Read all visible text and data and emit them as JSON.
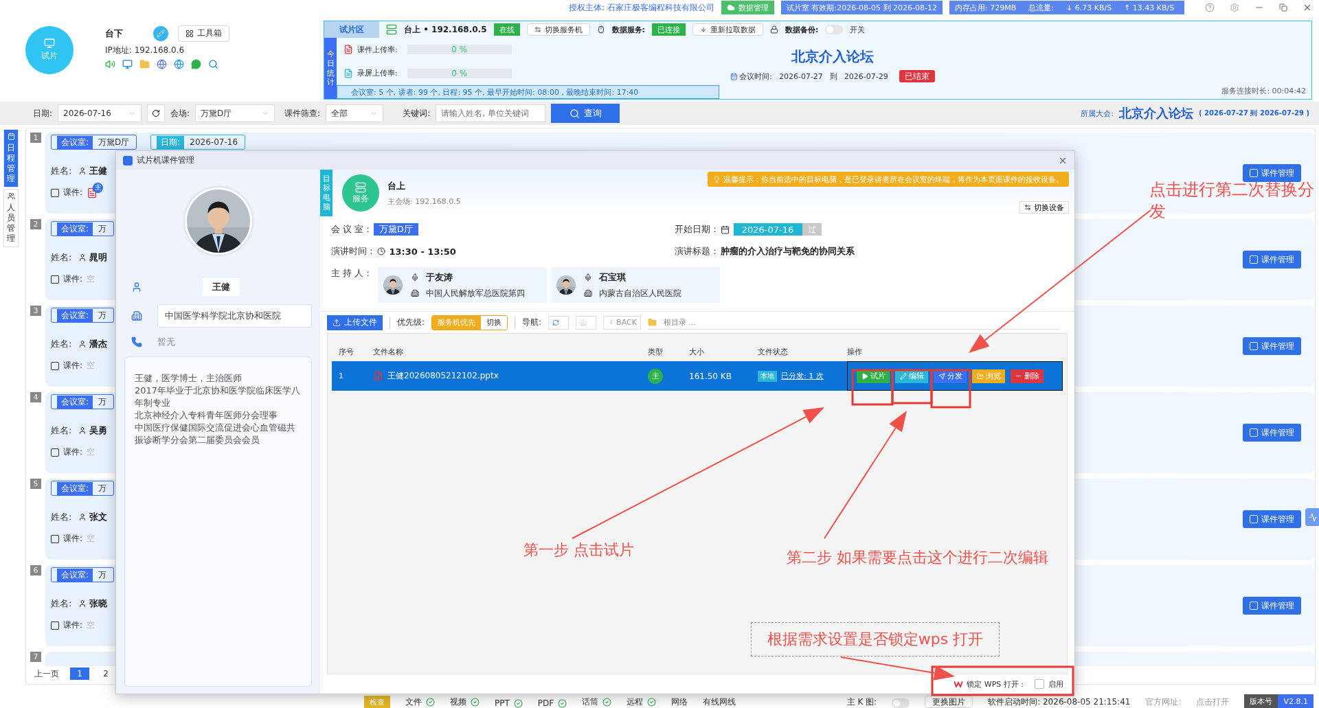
{
  "header": {
    "avatar_label": "试片",
    "role": "台下",
    "toolbox_button": "工具箱",
    "ip": "IP地址: 192.168.0.6"
  },
  "top_bar": {
    "licensee": "授权主体: 石家庄极客编程科技有限公司",
    "data_button": "数据管理",
    "validity": "试片室 有效期:2026-08-05 到 2026-08-12",
    "memory": "内存占用:  729MB",
    "traffic_label": "总流量:",
    "download": "↓ 6.73 KB/S",
    "upload": "↑ 13.43 KB/S"
  },
  "info_panel": {
    "tab": "试片区",
    "server": "台上 • 192.168.0.5",
    "server_status": "在线",
    "switch_server": "切换服务机",
    "data_service_label": "数据服务:",
    "data_service_status": "已连接",
    "refetch_button": "重新拉取数据",
    "backup_label": "数据备份:",
    "backup_on": false,
    "backup_switch_label": "开关",
    "stats_label": "今日统计",
    "rates": [
      {
        "label": "课件上传率:",
        "level": 0,
        "reading": "0 %"
      },
      {
        "label": "录屏上传率:",
        "level": 0,
        "reading": "0 %"
      }
    ],
    "summary": "会议室:  5 个,  讲者:  99 个,  日程:  95 个,  最早开始时间:  08:00 ,    最晚结束时间:  17:40",
    "conference": "北京介入论坛",
    "meeting_time_label": "会议时间:",
    "meeting_start": "2026-07-27",
    "meeting_to": "到",
    "meeting_end": "2026-07-29",
    "meeting_status": "已结束",
    "uptime": "服务连接时长: 00:04:42"
  },
  "filter_bar": {
    "date_label": "日期:",
    "date": "2026-07-16",
    "venue_label": "会场:",
    "venue": "万黛D厅",
    "course_filter_label": "课件筛查:",
    "course_filter": "全部",
    "keyword_label": "关键词:",
    "keyword_placeholder": "请输入姓名, 单位关键词",
    "search_button": "查询",
    "conference_label": "所属大会:",
    "conference": "北京介入论坛",
    "conference_dates": "( 2026-07-27 到 2026-07-29 )"
  },
  "side_nav": [
    {
      "label": "日程管理",
      "selected": true
    },
    {
      "label": "人员管理",
      "selected": false
    }
  ],
  "schedule_cards": [
    {
      "number": "1",
      "room_label": "会议室:",
      "room": "万黛D厅",
      "date_label": "日期:",
      "date": "2026-07-16",
      "name_label": "姓名:",
      "name": "王健",
      "course_label": "课件:",
      "course": {
        "kind": "file",
        "badge": "主"
      },
      "manage_button": "课件管理"
    },
    {
      "number": "2",
      "room_label": "会议室:",
      "room": "万",
      "name_label": "姓名:",
      "name": "晁明",
      "course_label": "课件:",
      "course": {
        "kind": "empty",
        "text": "空"
      },
      "manage_button": "课件管理"
    },
    {
      "number": "3",
      "room_label": "会议室:",
      "room": "万",
      "name_label": "姓名:",
      "name": "潘杰",
      "course_label": "课件:",
      "course": {
        "kind": "empty",
        "text": "空"
      },
      "manage_button": "课件管理"
    },
    {
      "number": "4",
      "room_label": "会议室:",
      "room": "万",
      "name_label": "姓名:",
      "name": "吴勇",
      "course_label": "课件:",
      "course": {
        "kind": "empty",
        "text": "空"
      },
      "manage_button": "课件管理"
    },
    {
      "number": "5",
      "room_label": "会议室:",
      "room": "万",
      "name_label": "姓名:",
      "name": "张文",
      "course_label": "课件:",
      "course": {
        "kind": "empty",
        "text": "空"
      },
      "manage_button": "课件管理"
    },
    {
      "number": "6",
      "room_label": "会议室:",
      "room": "万",
      "name_label": "姓名:",
      "name": "张晓",
      "course_label": "课件:",
      "course": {
        "kind": "empty",
        "text": "空"
      },
      "manage_button": "课件管理"
    },
    {
      "number": "7"
    }
  ],
  "pagination": {
    "prev": "上一页",
    "pages": [
      {
        "label": "1",
        "selected": true
      },
      {
        "label": "2",
        "selected": false
      }
    ]
  },
  "status_bar": {
    "check_button": "检查",
    "checks": [
      "文件",
      "视频",
      "PPT",
      "PDF",
      "话筒",
      "远程"
    ],
    "network_label": "网络",
    "network": "有线网线",
    "k_image_label": "主 K 图:",
    "k_image_on": false,
    "change_image": "更换图片",
    "start_time": "软件启动时间: 2026-08-05 21:15:41",
    "website_label": "官方网址:",
    "website_link": "点击打开",
    "version_label": "版本号",
    "version": "V2.8.1"
  },
  "dialog": {
    "title": "试片机课件管理",
    "speaker": {
      "name": "王健",
      "hospital": "中国医学科学院北京协和医院",
      "phone": "暂无",
      "bio": [
        "王健，医学博士，主治医师",
        "2017年毕业于北京协和医学院临床医学八年制专业",
        "北京神经介入专科青年医师分会理事",
        "中国医疗保健国际交流促进会心血管磁共振诊断学分会第二届委员会会员"
      ]
    },
    "target": {
      "label": "目标电脑",
      "badge": "服务",
      "name": "台上",
      "address": "主会场: 192.168.0.5",
      "tip": "温馨提示：你当前选中的目标电脑，是已登录讲者所在会议室的终端，将作为本页面课件的接收设备。",
      "switch_button": "切换设备"
    },
    "room_label": "会 议 室 :",
    "room": "万黛D厅",
    "start_label": "开始日期 :",
    "start_date": "2026-07-16",
    "start_badge": "过",
    "time_label": "演讲时间 :",
    "time": "13:30 - 13:50",
    "topic_label": "演讲标题 :",
    "topic": "肿瘤的介入治疗与靶免的协同关系",
    "hosts_label": "主 持 人 :",
    "hosts": [
      {
        "name": "于友涛",
        "org": "中国人民解放军总医院第四"
      },
      {
        "name": "石宝琪",
        "org": "内蒙古自治区人民医院"
      }
    ],
    "toolbar": {
      "upload": "上传文件",
      "priority_label": "优先级:",
      "priority_options": [
        {
          "label": "服务机优先",
          "selected": true
        },
        {
          "label": "切换",
          "selected": false
        }
      ],
      "nav_label": "导航:",
      "back": "BACK",
      "path": "根目录 ..."
    },
    "table": {
      "columns": [
        "序号",
        "文件名称",
        "类型",
        "大小",
        "文件状态",
        "操作"
      ],
      "rows": [
        {
          "index": "1",
          "file": "王健20260805212102.pptx",
          "type": "主",
          "size": "161.50 KB",
          "location": "本地",
          "distributed": "已分发: 1 次",
          "selected": true,
          "actions": [
            {
              "kind": "play",
              "label": "试片"
            },
            {
              "kind": "edit",
              "label": "编辑"
            },
            {
              "kind": "send",
              "label": "分发"
            },
            {
              "kind": "browse",
              "label": "浏览"
            },
            {
              "kind": "delete",
              "label": "删除"
            }
          ]
        }
      ]
    },
    "wps_lock": {
      "label": "锁定 WPS 打开 :",
      "checked": false,
      "option": "启用"
    }
  },
  "annotations": [
    "第一步  点击试片",
    "第二步 如果需要点击这个进行二次编辑",
    "点击进行第二次替换分发",
    "根据需求设置是否锁定wps 打开"
  ]
}
